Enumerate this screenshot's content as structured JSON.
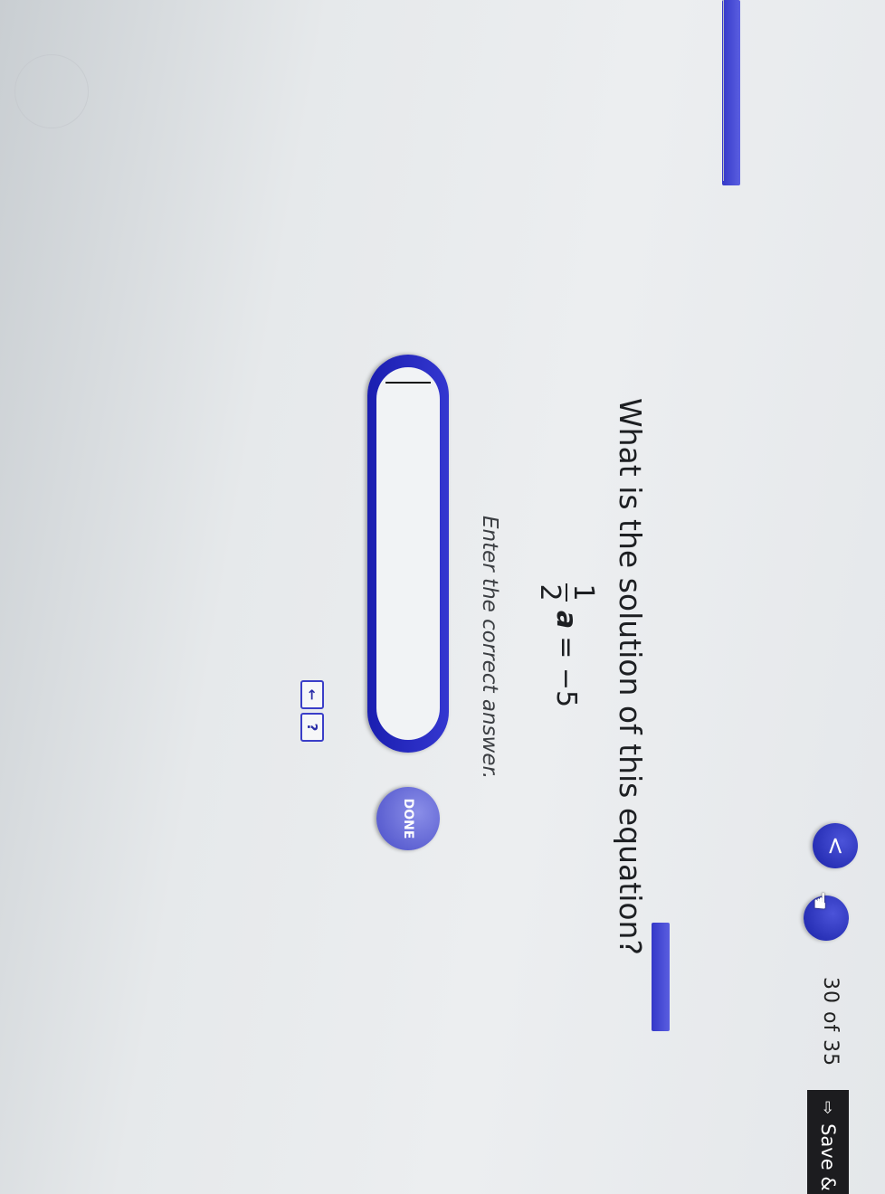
{
  "header": {
    "progress_text": "30 of 35",
    "save_label": "Save &",
    "back_glyph": "<",
    "hand_icon": "hand-pointer-icon"
  },
  "question": {
    "prompt": "What is the solution of this equation?",
    "equation": {
      "numerator": "1",
      "denominator": "2",
      "variable": "a",
      "rhs": "= −5"
    },
    "instruction": "Enter the correct answer."
  },
  "answer": {
    "value": "",
    "done_label": "DONE"
  },
  "keys": {
    "back": "←",
    "help": "?"
  },
  "colors": {
    "accent": "#3437d0",
    "band": "#4a4ee0",
    "save_bg": "#1c1c1f"
  }
}
